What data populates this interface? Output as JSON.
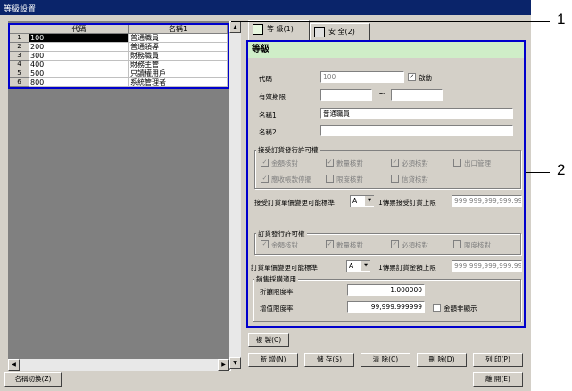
{
  "window": {
    "title": "等級設置"
  },
  "grid": {
    "headers": [
      "代碼",
      "名稱1"
    ],
    "rows": [
      {
        "num": "1",
        "code": "100",
        "name": "普通職員"
      },
      {
        "num": "2",
        "code": "200",
        "name": "普通領導"
      },
      {
        "num": "3",
        "code": "300",
        "name": "財務職員"
      },
      {
        "num": "4",
        "code": "400",
        "name": "財務主管"
      },
      {
        "num": "5",
        "code": "500",
        "name": "只讀權用戶"
      },
      {
        "num": "6",
        "code": "800",
        "name": "系統管理者"
      }
    ]
  },
  "tabs": [
    {
      "label": "等 級(1)",
      "icon": "book-icon"
    },
    {
      "label": "安 全(2)",
      "icon": "notebook-icon"
    }
  ],
  "panel": {
    "title": "等級",
    "code_label": "代碼",
    "code_value": "100",
    "enabled_label": "啟動",
    "enabled_checked": true,
    "validity_label": "有效期限",
    "validity_from": "",
    "validity_sep": "~",
    "validity_to": "",
    "name1_label": "名稱1",
    "name1_value": "普通職員",
    "name2_label": "名稱2",
    "name2_value": "",
    "receive_group": {
      "title": "接受訂貨發行許可權",
      "checks": [
        "金額核對",
        "數量核對",
        "必須核對",
        "出口管理",
        "應收帳款停擺",
        "限度核對",
        "信貸核對"
      ],
      "price_change_label": "接受訂貨單價變更可能標準",
      "price_change_value": "A",
      "limit_label": "1傳票接受訂貨上限",
      "limit_value": "999,999,999,999.99"
    },
    "order_group": {
      "title": "訂貨發行許可權",
      "checks": [
        "金額核對",
        "數量核對",
        "必須核對",
        "限度核對"
      ],
      "price_change_label": "訂貨單價變更可能標準",
      "price_change_value": "A",
      "limit_label": "1傳票訂貨金額上限",
      "limit_value": "999,999,999,999.99"
    },
    "sales_group": {
      "title": "銷售採購適用",
      "discount_label": "折讓限度率",
      "discount_value": "1.000000",
      "markup_label": "增值限度率",
      "markup_value": "99,999.999999",
      "hide_amount_label": "金額非顯示"
    }
  },
  "buttons": {
    "copy": "複 製(C)",
    "new": "新 增(N)",
    "save": "儲 存(S)",
    "clear": "清 除(C)",
    "delete": "刪 除(D)",
    "print": "列 印(P)",
    "switch_name": "名稱切換(Z)",
    "close": "離 開(E)"
  },
  "callouts": [
    "1",
    "2"
  ]
}
